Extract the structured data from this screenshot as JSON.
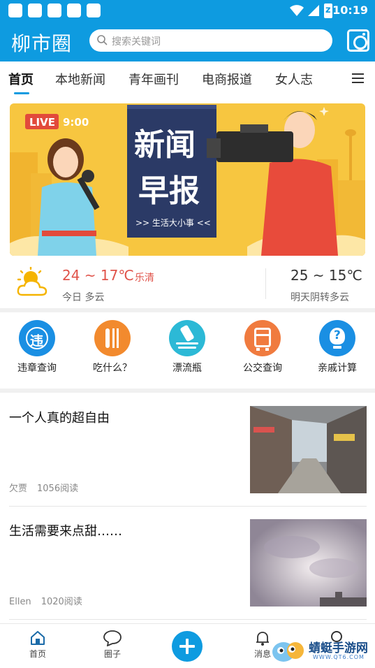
{
  "status_bar": {
    "time": "10:19",
    "battery_glyph": "z"
  },
  "header": {
    "logo": "柳市圈",
    "search_placeholder": "搜索关键词"
  },
  "tabs": [
    {
      "label": "首页",
      "active": true
    },
    {
      "label": "本地新闻"
    },
    {
      "label": "青年画刊"
    },
    {
      "label": "电商报道"
    },
    {
      "label": "女人志"
    }
  ],
  "banner": {
    "badge": "LIVE",
    "time": "9:00",
    "title_line1": "新闻",
    "title_line2": "早报",
    "subtitle": ">> 生活大小事 <<"
  },
  "weather": {
    "today_temp": "24 ~ 17℃",
    "city": "乐清",
    "today_desc": "今日 多云",
    "tomorrow_temp": "25 ~ 15℃",
    "tomorrow_desc": "明天阴转多云"
  },
  "quick_tools": [
    {
      "label": "违章查询",
      "icon": "traffic-violation-icon",
      "color": "#1a8fe3",
      "glyph": "违"
    },
    {
      "label": "吃什么？",
      "icon": "utensils-icon",
      "color": "#f28a2e"
    },
    {
      "label": "漂流瓶",
      "icon": "drift-bottle-icon",
      "color": "#2cb9d6"
    },
    {
      "label": "公交查询",
      "icon": "bus-icon",
      "color": "#f07b3f"
    },
    {
      "label": "亲戚计算",
      "icon": "lightbulb-question-icon",
      "color": "#1a8fe3",
      "glyph": "?"
    }
  ],
  "news": [
    {
      "title": "一个人真的超自由",
      "author": "欠贾",
      "reads": "1056阅读"
    },
    {
      "title": "生活需要来点甜……",
      "author": "Ellen",
      "reads": "1020阅读"
    }
  ],
  "bottom_nav": [
    {
      "label": "首页",
      "icon": "home-icon",
      "active": true
    },
    {
      "label": "圈子",
      "icon": "chat-bubble-icon"
    },
    {
      "label": "消息",
      "icon": "bell-icon"
    }
  ],
  "watermark": {
    "title": "蜻蜓手游网",
    "url": "WWW.QT6.COM"
  }
}
